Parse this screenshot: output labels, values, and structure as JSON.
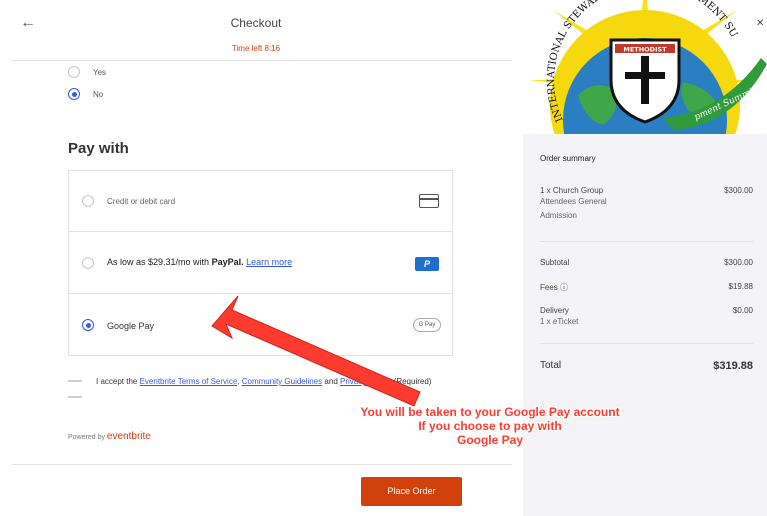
{
  "header": {
    "back_icon": "arrow-left-icon",
    "title": "Checkout",
    "timer": "Time left 8:16"
  },
  "prior_question": {
    "options": [
      {
        "label": "Yes",
        "selected": false
      },
      {
        "label": "No",
        "selected": true
      }
    ]
  },
  "payment": {
    "heading": "Pay with",
    "options": [
      {
        "label": "Credit or debit card",
        "icon": "credit-card-icon",
        "selected": false
      },
      {
        "prefix": "As low as $29.31/mo with ",
        "brand": "PayPal.",
        "link": "Learn more",
        "icon": "paypal-icon",
        "icon_text": "P",
        "selected": false
      },
      {
        "label": "Google Pay",
        "icon": "google-pay-icon",
        "icon_text": "G Pay",
        "selected": true
      }
    ]
  },
  "terms": {
    "prefix": "I accept the ",
    "link1": "Eventbrite Terms of Service",
    "sep": ", ",
    "link2": "Community Guidelines",
    "and": " and ",
    "link3": "Privacy Policy",
    "suffix": ". (Required)"
  },
  "footer": {
    "powered_prefix": "Powered by ",
    "powered_brand": "eventbrite",
    "place_order": "Place Order"
  },
  "summary": {
    "close_icon": "close-icon",
    "logo_text": "INTERNATIONAL STEWARDSHIP & DEVELOPMENT SUMMIT",
    "logo_banner": "METHODIST",
    "title": "Order summary",
    "item_name": "1 x Church Group",
    "item_sub1": "Attendees General",
    "item_sub2": "Admission",
    "item_amount": "$300.00",
    "subtotal_label": "Subtotal",
    "subtotal_amount": "$300.00",
    "fees_label": "Fees ⓘ",
    "fees_amount": "$19.88",
    "delivery_label": "Delivery",
    "delivery_sub": "1 x eTicket",
    "delivery_amount": "$0.00",
    "total_label": "Total",
    "total_amount": "$319.88"
  },
  "annotation": {
    "line1": "You will be taken to your Google Pay account",
    "line2": "If you choose to pay with",
    "line3": "Google Pay",
    "color": "#ff3b2f"
  },
  "colors": {
    "brand_orange": "#d1410c",
    "link_blue": "#3659e3",
    "paypal_blue": "#1f6fcf"
  }
}
